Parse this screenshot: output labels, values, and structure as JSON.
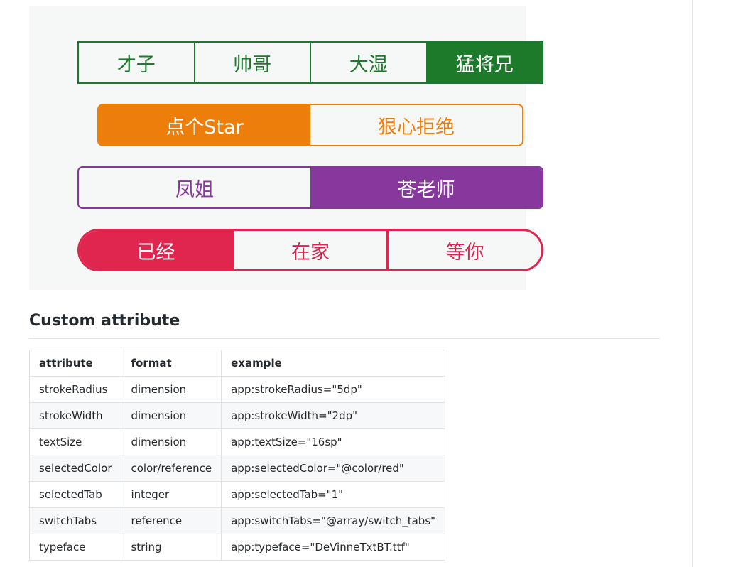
{
  "demo": {
    "row1": {
      "tabs": [
        "才子",
        "帅哥",
        "大湿",
        "猛将兄"
      ],
      "selected_index": 3,
      "color": "#1e7a2b"
    },
    "row2": {
      "tabs": [
        "点个Star",
        "狠心拒绝"
      ],
      "selected_index": 0,
      "color": "#ee7e0a"
    },
    "row3": {
      "tabs": [
        "凤姐",
        "苍老师"
      ],
      "selected_index": 1,
      "color": "#87389c"
    },
    "row4": {
      "tabs": [
        "已经",
        "在家",
        "等你"
      ],
      "selected_index": 0,
      "color": "#e0264f"
    }
  },
  "section": {
    "heading": "Custom attribute"
  },
  "table": {
    "headers": [
      "attribute",
      "format",
      "example"
    ],
    "rows": [
      [
        "strokeRadius",
        "dimension",
        "app:strokeRadius=\"5dp\""
      ],
      [
        "strokeWidth",
        "dimension",
        "app:strokeWidth=\"2dp\""
      ],
      [
        "textSize",
        "dimension",
        "app:textSize=\"16sp\""
      ],
      [
        "selectedColor",
        "color/reference",
        "app:selectedColor=\"@color/red\""
      ],
      [
        "selectedTab",
        "integer",
        "app:selectedTab=\"1\""
      ],
      [
        "switchTabs",
        "reference",
        "app:switchTabs=\"@array/switch_tabs\""
      ],
      [
        "typeface",
        "string",
        "app:typeface=\"DeVinneTxtBT.ttf\""
      ]
    ]
  }
}
